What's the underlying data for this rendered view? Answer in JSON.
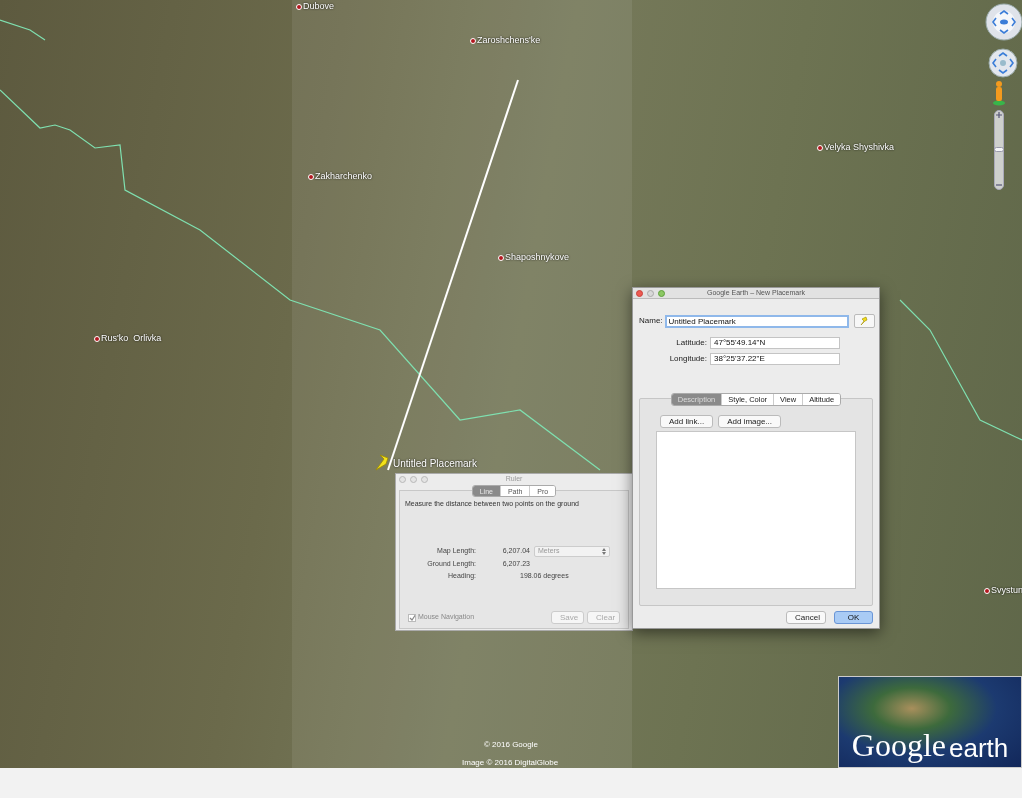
{
  "map": {
    "places": [
      {
        "label": "Dubove"
      },
      {
        "label": "Zaroshchens'ke"
      },
      {
        "label": "Zakharchenko"
      },
      {
        "label": "Shaposhnykove"
      },
      {
        "label": "Velyka Shyshivka"
      },
      {
        "label": "Rus'ko  Orlivka"
      },
      {
        "label": "Svystun"
      }
    ],
    "placemark_label": "Untitled Placemark",
    "copyright": [
      "© 2016 Google",
      "Image © 2016 DigitalGlobe"
    ],
    "zoom_slider": {
      "level": 0.5
    },
    "logo": {
      "word_1": "Google",
      "word_2": "earth"
    }
  },
  "ruler": {
    "title": "Ruler",
    "tabs": [
      {
        "label": "Line",
        "selected": true
      },
      {
        "label": "Path",
        "selected": false
      },
      {
        "label": "Pro",
        "selected": false
      }
    ],
    "description": "Measure the distance between two points on the ground",
    "rows": [
      {
        "label": "Map Length:",
        "value": "6,207.04"
      },
      {
        "label": "Ground Length:",
        "value": "6,207.23"
      },
      {
        "label": "Heading:",
        "value": "198.06 degrees"
      }
    ],
    "units": "Meters",
    "mouse_navigation": {
      "label": "Mouse Navigation",
      "checked": true
    },
    "buttons": [
      "Save",
      "Clear"
    ]
  },
  "placemark_dialog": {
    "title": "Google Earth – New Placemark",
    "name_label": "Name:",
    "name_value": "Untitled Placemark",
    "latitude_label": "Latitude:",
    "latitude": "47°55'49.14\"N",
    "longitude_label": "Longitude:",
    "longitude": "38°25'37.22\"E",
    "tabs": [
      {
        "label": "Description",
        "selected": true
      },
      {
        "label": "Style, Color",
        "selected": false
      },
      {
        "label": "View",
        "selected": false
      },
      {
        "label": "Altitude",
        "selected": false
      }
    ],
    "add_buttons": [
      "Add link...",
      "Add image..."
    ],
    "cancel": "Cancel",
    "ok": "OK"
  }
}
